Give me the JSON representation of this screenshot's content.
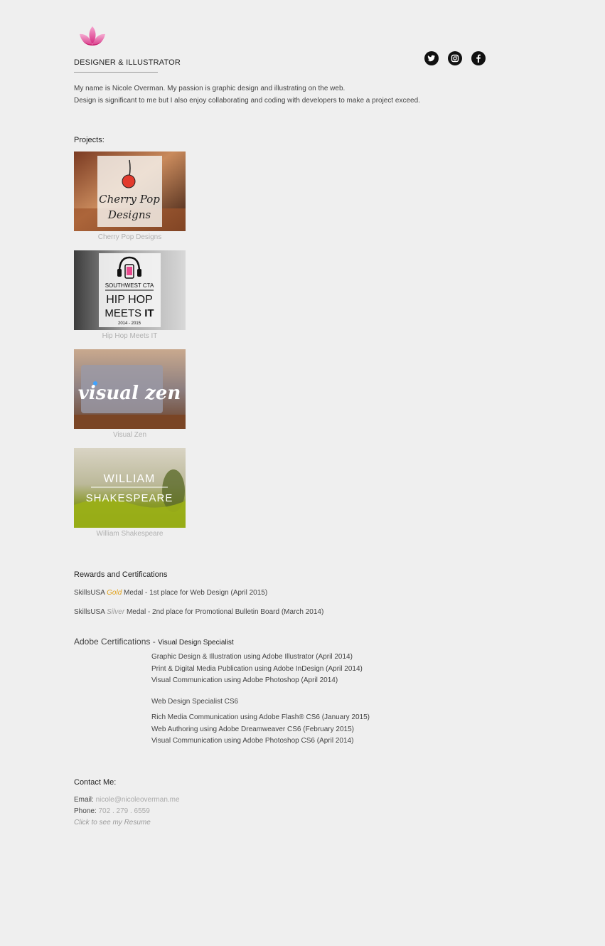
{
  "header": {
    "tagline": "DESIGNER & ILLUSTRATOR",
    "logo_icon": "lotus-icon",
    "social": [
      {
        "name": "twitter-icon"
      },
      {
        "name": "instagram-icon"
      },
      {
        "name": "facebook-icon"
      }
    ]
  },
  "intro": {
    "line1": "My name is Nicole Overman. My passion is graphic design and illustrating on the web.",
    "line2": "Design is significant to me but I also enjoy collaborating and coding with developers to make a project exceed."
  },
  "projects": {
    "title": "Projects:",
    "items": [
      {
        "caption": "Cherry Pop Designs",
        "image_line1": "Cherry Pop",
        "image_line2": "Designs"
      },
      {
        "caption": "Hip Hop Meets IT",
        "image_line1": "SOUTHWEST CTA",
        "image_line2": "HIP HOP",
        "image_line3_a": "MEETS",
        "image_line3_b": "IT",
        "image_line4": "2014 - 2015"
      },
      {
        "caption": "Visual Zen",
        "image_line1": "visual zen"
      },
      {
        "caption": "William Shakespeare",
        "image_line1": "WILLIAM",
        "image_line2": "SHAKESPEARE"
      }
    ]
  },
  "rewards": {
    "title": "Rewards and Certifications",
    "items": [
      {
        "prefix": "SkillsUSA",
        "medal": "Gold",
        "rest": "Medal - 1st place for Web Design (April 2015)"
      },
      {
        "prefix": "SkillsUSA",
        "medal": "Silver",
        "rest": "Medal - 2nd place for Promotional Bulletin Board (March 2014)"
      }
    ]
  },
  "adobe": {
    "label": "Adobe Certifications - ",
    "groups": [
      {
        "heading": "Visual Design Specialist",
        "items": [
          "Graphic Design & Illustration using Adobe Illustrator (April 2014)",
          "Print & Digital Media Publication using Adobe InDesign (April 2014)",
          "Visual Communication using Adobe Photoshop (April 2014)"
        ]
      },
      {
        "heading": "Web Design Specialist CS6",
        "items": [
          "Rich Media Communication using Adobe Flash® CS6 (January 2015)",
          "Web Authoring using Adobe Dreamweaver CS6 (February 2015)",
          "Visual Communication using Adobe Photoshop CS6 (April 2014)"
        ]
      }
    ]
  },
  "contact": {
    "title": "Contact Me:",
    "email_label": "Email: ",
    "email": "nicole@nicoleoverman.me",
    "phone_label": "Phone: ",
    "phone": "702 . 279 . 6559",
    "resume": "Click to see my Resume"
  },
  "colors": {
    "background": "#efefef",
    "gold": "#e0a21c",
    "accent_pink": "#e8418e"
  }
}
